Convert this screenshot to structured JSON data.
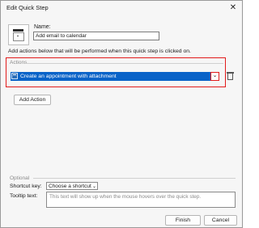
{
  "window": {
    "title": "Edit Quick Step",
    "close_glyph": "✕"
  },
  "name": {
    "label": "Name:",
    "value": "Add email to calendar"
  },
  "instructions": "Add actions below that will be performed when this quick step is clicked on.",
  "actions": {
    "legend": "Actions",
    "selected_action": "Create an appointment with attachment",
    "dropdown_glyph": "⌄",
    "add_button": "Add Action"
  },
  "optional": {
    "legend": "Optional",
    "shortcut_label": "Shortcut key:",
    "shortcut_value": "Choose a shortcut",
    "tooltip_label": "Tooltip text:",
    "tooltip_placeholder": "This text will show up when the mouse hovers over the quick step."
  },
  "footer": {
    "finish": "Finish",
    "cancel": "Cancel"
  },
  "colors": {
    "accent": "#0a63c8",
    "highlight": "#e21b1b"
  }
}
